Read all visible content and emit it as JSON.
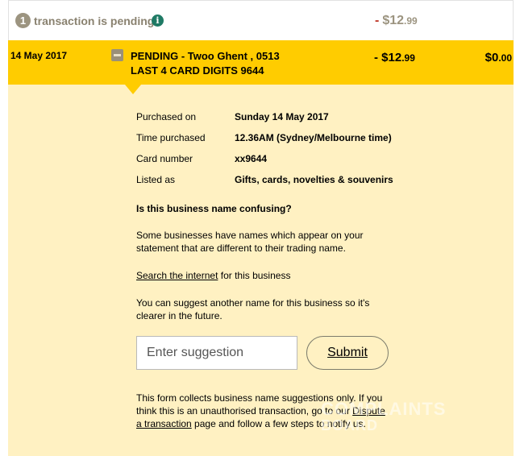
{
  "pending_summary": {
    "count": "1",
    "text": "transaction is pending",
    "amount_sign": "-",
    "amount_dollars": "$12",
    "amount_cents": ".99"
  },
  "transaction": {
    "date": "14 May 2017",
    "desc_line1": "PENDING - Twoo Ghent , 0513",
    "desc_line2": "LAST 4 CARD DIGITS 9644",
    "amount_sign": "-",
    "amount_dollars": "$12",
    "amount_cents": ".99",
    "balance_dollars": "$0",
    "balance_cents": ".00"
  },
  "details": {
    "purchased_on_label": "Purchased on",
    "purchased_on_value": "Sunday 14 May 2017",
    "time_label": "Time purchased",
    "time_value": "12.36AM (Sydney/Melbourne time)",
    "card_label": "Card number",
    "card_value": "xx9644",
    "listed_label": "Listed as",
    "listed_value": "Gifts, cards, novelties & souvenirs"
  },
  "confusing": {
    "heading": "Is this business name confusing?",
    "para1": "Some businesses have names which appear on your statement that are different to their trading name.",
    "search_link": "Search the internet",
    "search_suffix": " for this business",
    "para2": "You can suggest another name for this business so it's clearer in the future.",
    "input_placeholder": "Enter suggestion",
    "submit_label": "Submit",
    "footer_prefix": "This form collects business name suggestions only. If you think this is an unauthorised transaction, go to our ",
    "dispute_link": "Dispute a transaction",
    "footer_suffix": " page and follow a few steps to notify us."
  },
  "watermark": {
    "line1": "COMPLAINTS",
    "line2": "BOARD"
  },
  "colors": {
    "header_yellow": "#ffcc00",
    "panel_cream": "#fff1c2",
    "info_green": "#1f7a65",
    "minus_red": "#c0392b"
  }
}
